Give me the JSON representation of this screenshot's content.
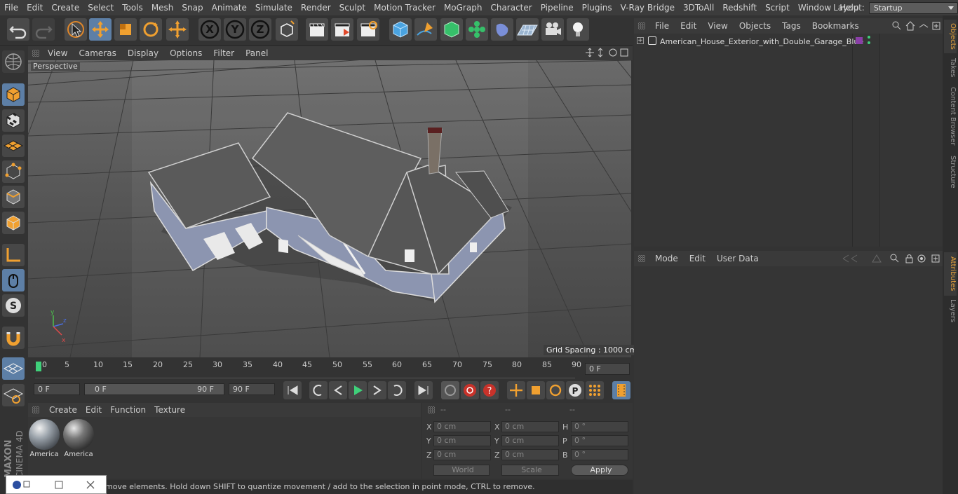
{
  "menubar": {
    "items": [
      "File",
      "Edit",
      "Create",
      "Select",
      "Tools",
      "Mesh",
      "Snap",
      "Animate",
      "Simulate",
      "Render",
      "Sculpt",
      "Motion Tracker",
      "MoGraph",
      "Character",
      "Pipeline",
      "Plugins",
      "V-Ray Bridge",
      "3DToAll",
      "Redshift",
      "Script",
      "Window",
      "Help"
    ],
    "layout_label": "Layout:",
    "layout_value": "Startup"
  },
  "toolbar": {
    "axis_x": "X",
    "axis_y": "Y",
    "axis_z": "Z"
  },
  "viewport": {
    "menu": [
      "View",
      "Cameras",
      "Display",
      "Options",
      "Filter",
      "Panel"
    ],
    "label": "Perspective",
    "grid_spacing": "Grid Spacing : 1000 cm"
  },
  "timeline": {
    "ticks": [
      "0",
      "5",
      "10",
      "15",
      "20",
      "25",
      "30",
      "35",
      "40",
      "45",
      "50",
      "55",
      "60",
      "65",
      "70",
      "75",
      "80",
      "85",
      "90"
    ],
    "current_frame": "0 F"
  },
  "transport": {
    "start_field": "0 F",
    "range_start": "0 F",
    "range_end": "90 F",
    "end_field": "90 F"
  },
  "materials": {
    "menu": [
      "Create",
      "Edit",
      "Function",
      "Texture"
    ],
    "items": [
      "America",
      "America"
    ]
  },
  "coords": {
    "headers": [
      "--",
      "--",
      "--"
    ],
    "rows": [
      {
        "a": "X",
        "av": "0 cm",
        "b": "X",
        "bv": "0 cm",
        "c": "H",
        "cv": "0 °"
      },
      {
        "a": "Y",
        "av": "0 cm",
        "b": "Y",
        "bv": "0 cm",
        "c": "P",
        "cv": "0 °"
      },
      {
        "a": "Z",
        "av": "0 cm",
        "b": "Z",
        "bv": "0 cm",
        "c": "B",
        "cv": "0 °"
      }
    ],
    "world": "World",
    "scale": "Scale",
    "apply": "Apply"
  },
  "objects": {
    "menu": [
      "File",
      "Edit",
      "View",
      "Objects",
      "Tags",
      "Bookmarks"
    ],
    "item": "American_House_Exterior_with_Double_Garage_Blue"
  },
  "attributes": {
    "menu": [
      "Mode",
      "Edit",
      "User Data"
    ]
  },
  "sidetabs": [
    "Objects",
    "Takes",
    "Content Browser",
    "Structure",
    "Attributes",
    "Layers"
  ],
  "statusbar": "move elements. Hold down SHIFT to quantize movement / add to the selection in point mode, CTRL to remove.",
  "branding": "MAXON CINEMA 4D",
  "colors": {
    "accent": "#5d7fa6",
    "selected_tab": "#e8a33c",
    "wall_blue": "#8c95b0",
    "roof_gray": "#5a5a5a"
  }
}
